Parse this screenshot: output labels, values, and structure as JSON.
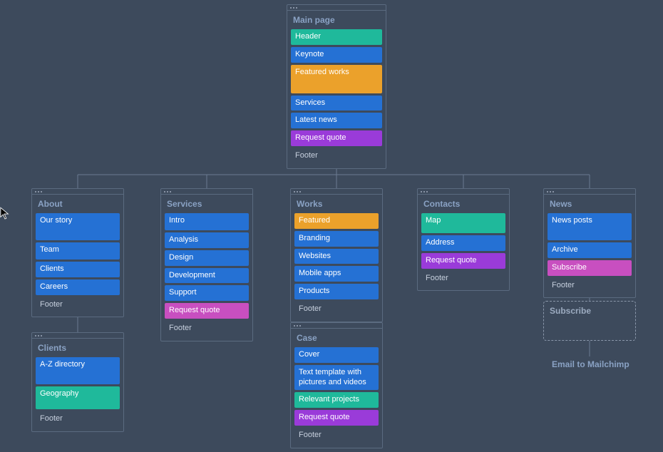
{
  "root": {
    "title": "Main page",
    "blocks": [
      {
        "label": "Header",
        "color": "teal",
        "h": 18
      },
      {
        "label": "Keynote",
        "color": "blue",
        "h": 18
      },
      {
        "label": "Featured works",
        "color": "orange",
        "h": 40
      },
      {
        "label": "Services",
        "color": "blue",
        "h": 18
      },
      {
        "label": "Latest news",
        "color": "blue",
        "h": 18
      },
      {
        "label": "Request quote",
        "color": "purple",
        "h": 18
      },
      {
        "label": "Footer",
        "color": "plain",
        "h": 16
      }
    ]
  },
  "columns": [
    {
      "title": "About",
      "blocks": [
        {
          "label": "Our story",
          "color": "blue",
          "h": 38
        },
        {
          "label": "Team",
          "color": "blue",
          "h": 24
        },
        {
          "label": "Clients",
          "color": "blue",
          "h": 18
        },
        {
          "label": "Careers",
          "color": "blue",
          "h": 18
        },
        {
          "label": "Footer",
          "color": "plain",
          "h": 16
        }
      ],
      "children": [
        {
          "title": "Clients",
          "blocks": [
            {
              "label": "A-Z directory",
              "color": "blue",
              "h": 38
            },
            {
              "label": "Geography",
              "color": "teal",
              "h": 32
            },
            {
              "label": "Footer",
              "color": "plain",
              "h": 16
            }
          ]
        }
      ]
    },
    {
      "title": "Services",
      "blocks": [
        {
          "label": "Intro",
          "color": "blue",
          "h": 24
        },
        {
          "label": "Analysis",
          "color": "blue",
          "h": 18
        },
        {
          "label": "Design",
          "color": "blue",
          "h": 18
        },
        {
          "label": "Development",
          "color": "blue",
          "h": 18
        },
        {
          "label": "Support",
          "color": "blue",
          "h": 18
        },
        {
          "label": "Request quote",
          "color": "pink",
          "h": 18
        },
        {
          "label": "Footer",
          "color": "plain",
          "h": 16
        }
      ]
    },
    {
      "title": "Works",
      "blocks": [
        {
          "label": "Featured",
          "color": "orange",
          "h": 18
        },
        {
          "label": "Branding",
          "color": "blue",
          "h": 18
        },
        {
          "label": "Websites",
          "color": "blue",
          "h": 18
        },
        {
          "label": "Mobile apps",
          "color": "blue",
          "h": 18
        },
        {
          "label": "Products",
          "color": "blue",
          "h": 18
        },
        {
          "label": "Footer",
          "color": "plain",
          "h": 16
        }
      ],
      "children": [
        {
          "title": "Case",
          "blocks": [
            {
              "label": "Cover",
              "color": "blue",
              "h": 18
            },
            {
              "label": "Text template with pictures and videos",
              "color": "blue",
              "h": 30
            },
            {
              "label": "Relevant projects",
              "color": "teal",
              "h": 18
            },
            {
              "label": "Request quote",
              "color": "purple",
              "h": 18
            },
            {
              "label": "Footer",
              "color": "plain",
              "h": 16
            }
          ]
        }
      ]
    },
    {
      "title": "Contacts",
      "blocks": [
        {
          "label": "Map",
          "color": "teal",
          "h": 28
        },
        {
          "label": "Address",
          "color": "blue",
          "h": 18
        },
        {
          "label": "Request quote",
          "color": "purple",
          "h": 18
        },
        {
          "label": "Footer",
          "color": "plain",
          "h": 16
        }
      ]
    },
    {
      "title": "News",
      "blocks": [
        {
          "label": "News posts",
          "color": "blue",
          "h": 38
        },
        {
          "label": "Archive",
          "color": "blue",
          "h": 18
        },
        {
          "label": "Subscribe",
          "color": "pink",
          "h": 18
        },
        {
          "label": "Footer",
          "color": "plain",
          "h": 16
        }
      ],
      "sub_card": {
        "title": "Subscribe"
      },
      "note": "Email to Mailchimp"
    }
  ],
  "colors": {
    "blue": "#2571d4",
    "teal": "#1fb99b",
    "orange": "#eba12b",
    "purple": "#9a3bd9",
    "pink": "#c84fc0",
    "plain": "transparent"
  }
}
